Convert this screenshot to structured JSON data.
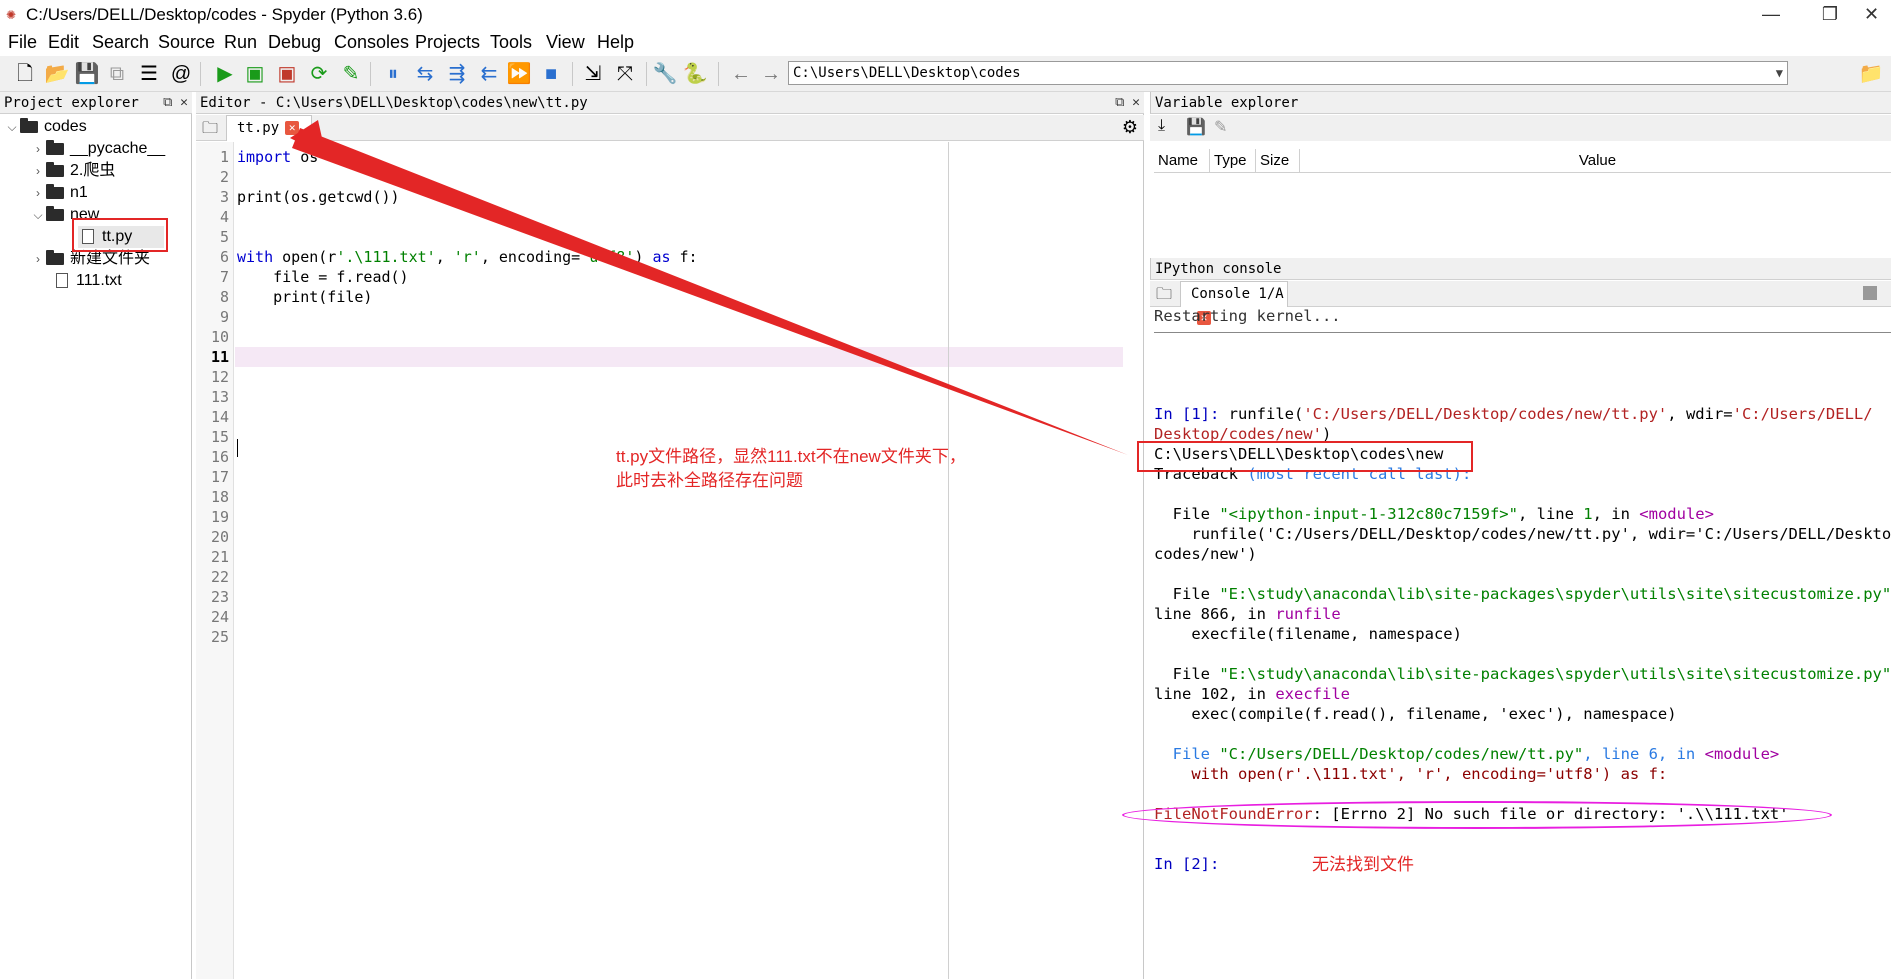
{
  "window": {
    "title": "C:/Users/DELL/Desktop/codes - Spyder (Python 3.6)",
    "minimize": "—",
    "maximize": "❐",
    "close": "✕"
  },
  "menu": [
    "File",
    "Edit",
    "Search",
    "Source",
    "Run",
    "Debug",
    "Consoles",
    "Projects",
    "Tools",
    "View",
    "Help"
  ],
  "toolbar": {
    "working_dir": "C:\\Users\\DELL\\Desktop\\codes"
  },
  "project_explorer": {
    "title": "Project explorer",
    "items": [
      {
        "label": "codes"
      },
      {
        "label": "__pycache__"
      },
      {
        "label": "2.爬虫"
      },
      {
        "label": "n1"
      },
      {
        "label": "new"
      },
      {
        "label": "tt.py"
      },
      {
        "label": "新建文件夹"
      },
      {
        "label": "111.txt"
      }
    ]
  },
  "editor": {
    "title": "Editor - C:\\Users\\DELL\\Desktop\\codes\\new\\tt.py",
    "tab": "tt.py",
    "line_numbers": [
      "1",
      "2",
      "3",
      "4",
      "5",
      "6",
      "7",
      "8",
      "9",
      "10",
      "11",
      "12",
      "13",
      "14",
      "15",
      "16",
      "17",
      "18",
      "19",
      "20",
      "21",
      "22",
      "23",
      "24",
      "25"
    ],
    "code": {
      "l1_kw": "import",
      "l1_rest": " os",
      "l3": "print(os.getcwd())",
      "l6_kw": "with",
      "l6_a": " open(r",
      "l6_s1": "'.\\111.txt'",
      "l6_b": ", ",
      "l6_s2": "'r'",
      "l6_c": ", encoding=",
      "l6_s3": "'utf8'",
      "l6_d": ") ",
      "l6_kw2": "as",
      "l6_e": " f:",
      "l7": "    file = f.read()",
      "l8": "    print(file)"
    }
  },
  "variable_explorer": {
    "title": "Variable explorer",
    "columns": [
      "Name",
      "Type",
      "Size",
      "Value"
    ]
  },
  "console": {
    "title": "IPython console",
    "tab": "Console 1/A",
    "restart": "Restarting kernel...",
    "in1_prompt": "In [1]:",
    "in1_cmd": " runfile(",
    "in1_s1": "'C:/Users/DELL/Desktop/codes/new/tt.py'",
    "in1_mid": ", wdir=",
    "in1_s2": "'C:/Users/DELL/",
    "in1_s2b": "Desktop/codes/new'",
    "in1_end": ")",
    "cwd_output": "C:\\Users\\DELL\\Desktop\\codes\\new",
    "traceback": "Traceback",
    "traceback_rest": " (most recent call last):",
    "tb1_a": "  File ",
    "tb1_file": "\"<ipython-input-1-312c80c7159f>\"",
    "tb1_b": ", line ",
    "tb1_line": "1",
    "tb1_c": ", in ",
    "tb1_mod": "<module>",
    "tb1_code": "    runfile('C:/Users/DELL/Desktop/codes/new/tt.py', wdir='C:/Users/DELL/Desktop/",
    "tb1_code2": "codes/new')",
    "tb2_a": "  File ",
    "tb2_file": "\"E:\\study\\anaconda\\lib\\site-packages\\spyder\\utils\\site\\sitecustomize.py\"",
    "tb2_b": ",",
    "tb2_line": "line 866, in ",
    "tb2_fn": "runfile",
    "tb2_code": "    execfile(filename, namespace)",
    "tb3_a": "  File ",
    "tb3_file": "\"E:\\study\\anaconda\\lib\\site-packages\\spyder\\utils\\site\\sitecustomize.py\"",
    "tb3_b": ",",
    "tb3_line": "line 102, in ",
    "tb3_fn": "execfile",
    "tb3_code": "    exec(compile(f.read(), filename, 'exec'), namespace)",
    "tb4_a": "  File ",
    "tb4_file": "\"C:/Users/DELL/Desktop/codes/new/tt.py\"",
    "tb4_b": ", line 6, in ",
    "tb4_mod": "<module>",
    "tb4_code": "    with open(r'.\\111.txt', 'r', encoding='utf8') as f:",
    "err_name": "FileNotFoundError",
    "err_msg": ": [Errno 2] No such file or directory: '.\\\\111.txt'",
    "in2_prompt": "In [2]:"
  },
  "annotations": {
    "path_note_1": "tt.py文件路径，显然111.txt不在new文件夹下，",
    "path_note_2": "此时去补全路径存在问题",
    "not_found_note": "无法找到文件",
    "color": "#e32626",
    "ellipse_color": "#e81ee0"
  }
}
